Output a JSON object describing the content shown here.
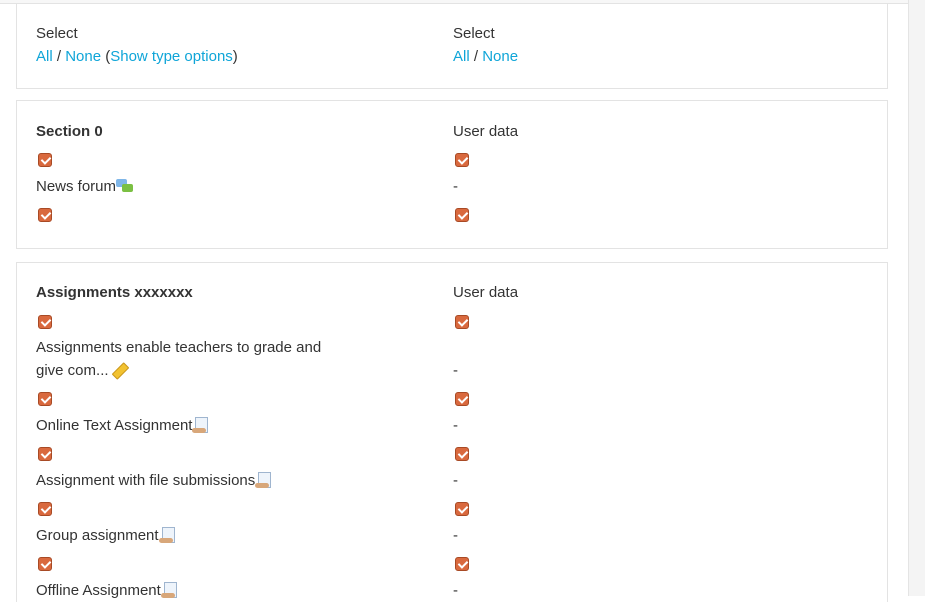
{
  "select_panel": {
    "left": {
      "title": "Select",
      "all": "All",
      "sep": " / ",
      "none": "None",
      "open_paren": " (",
      "type_options": "Show type options",
      "close_paren": ")"
    },
    "right": {
      "title": "Select",
      "all": "All",
      "sep": " / ",
      "none": "None"
    }
  },
  "section0": {
    "title": "Section 0",
    "user_data": "User data",
    "items": [
      {
        "label": "News forum",
        "icon": "forum-icon",
        "user_data": "-"
      }
    ]
  },
  "assignments": {
    "title": "Assignments xxxxxxx",
    "user_data": "User data",
    "items": [
      {
        "label_line1": "Assignments enable teachers to grade and",
        "label_line2": "give com...",
        "icon": "assignment-icon",
        "user_data": "-"
      },
      {
        "label": "Online Text Assignment",
        "icon": "assignment-page-icon",
        "user_data": "-"
      },
      {
        "label": "Assignment with file submissions",
        "icon": "assignment-page-icon",
        "user_data": "-"
      },
      {
        "label": "Group assignment",
        "icon": "assignment-page-icon",
        "user_data": "-"
      },
      {
        "label": "Offline Assignment",
        "icon": "assignment-page-icon",
        "user_data": "-"
      }
    ]
  },
  "colors": {
    "link": "#0fa5d8",
    "checkbox": "#d9693e",
    "text": "#333333"
  }
}
